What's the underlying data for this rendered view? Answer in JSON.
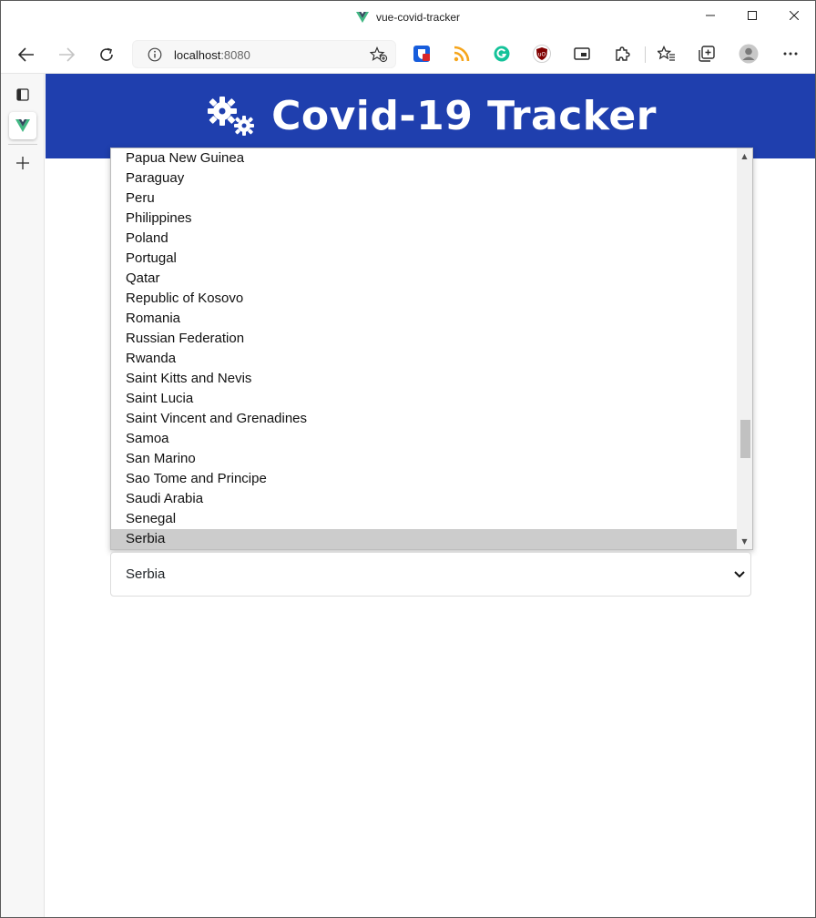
{
  "window": {
    "title": "vue-covid-tracker"
  },
  "toolbar": {
    "url_host": "localhost",
    "url_port": ":8080"
  },
  "header": {
    "title": "Covid-19 Tracker",
    "background": "#1f3fae"
  },
  "country_list": {
    "items": [
      "Papua New Guinea",
      "Paraguay",
      "Peru",
      "Philippines",
      "Poland",
      "Portugal",
      "Qatar",
      "Republic of Kosovo",
      "Romania",
      "Russian Federation",
      "Rwanda",
      "Saint Kitts and Nevis",
      "Saint Lucia",
      "Saint Vincent and Grenadines",
      "Samoa",
      "San Marino",
      "Sao Tome and Principe",
      "Saudi Arabia",
      "Senegal",
      "Serbia"
    ],
    "selected": "Serbia"
  },
  "select": {
    "value": "Serbia"
  }
}
